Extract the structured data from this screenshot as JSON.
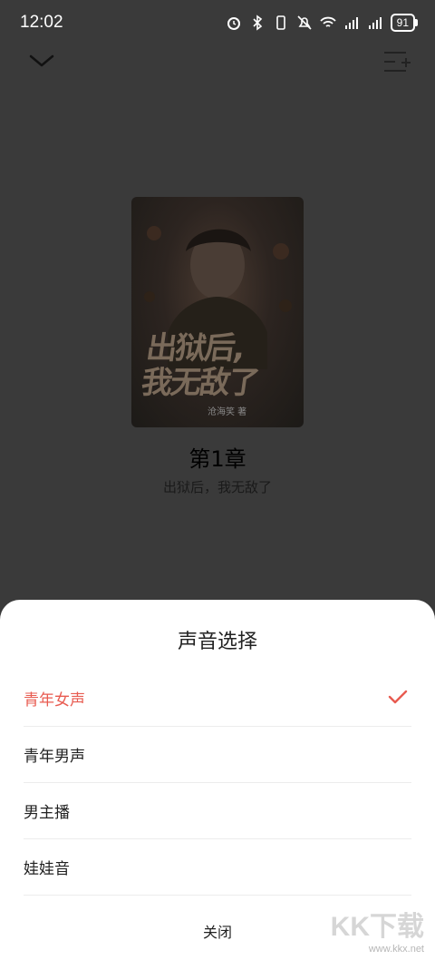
{
  "status_bar": {
    "time": "12:02",
    "battery": "91",
    "icons": [
      "alarm-icon",
      "bluetooth-icon",
      "vibrate-icon",
      "mute-icon",
      "wifi-icon",
      "signal-4g-1-icon",
      "signal-4g-2-icon"
    ]
  },
  "nav": {
    "collapse_icon": "chevron-down-icon",
    "playlist_icon": "playlist-add-icon"
  },
  "player": {
    "cover_title_line1": "出狱后,",
    "cover_title_line2": "我无敌了",
    "cover_author": "沧海笑  著",
    "chapter_title": "第1章",
    "book_name": "出狱后，我无敌了"
  },
  "voice_sheet": {
    "title": "声音选择",
    "options": [
      {
        "label": "青年女声",
        "selected": true
      },
      {
        "label": "青年男声",
        "selected": false
      },
      {
        "label": "男主播",
        "selected": false
      },
      {
        "label": "娃娃音",
        "selected": false
      }
    ],
    "close_label": "关闭",
    "accent_color": "#e85b50"
  },
  "watermark": {
    "logo": "KK下载",
    "url": "www.kkx.net"
  }
}
